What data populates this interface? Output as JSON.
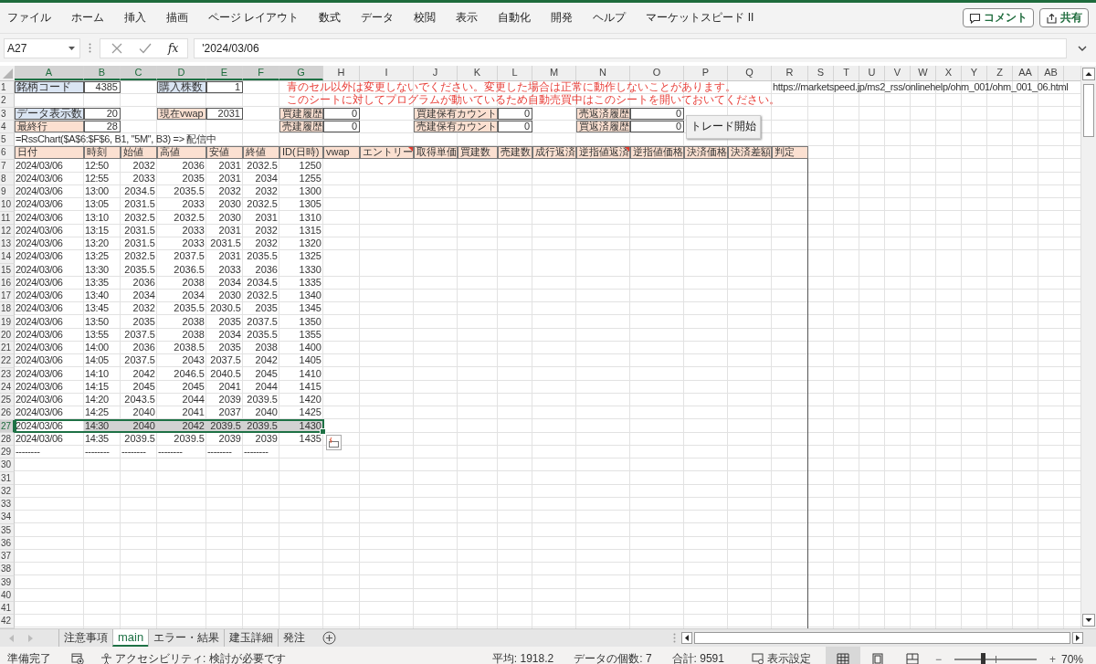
{
  "menu_tabs": [
    "ファイル",
    "ホーム",
    "挿入",
    "描画",
    "ページ レイアウト",
    "数式",
    "データ",
    "校閲",
    "表示",
    "自動化",
    "開発",
    "ヘルプ",
    "マーケットスピード II"
  ],
  "header_buttons": [
    {
      "kind": "comment",
      "label": "コメント"
    },
    {
      "kind": "share",
      "label": "共有"
    }
  ],
  "formula_bar": {
    "name_box": "A27",
    "function_label": "fx",
    "formula": "'2024/03/06"
  },
  "sheet": {
    "columns": [
      {
        "label": "A",
        "selected": true
      },
      {
        "label": "B",
        "selected": true
      },
      {
        "label": "C",
        "selected": true
      },
      {
        "label": "D",
        "selected": true
      },
      {
        "label": "E",
        "selected": true
      },
      {
        "label": "F",
        "selected": true
      },
      {
        "label": "G",
        "selected": true
      },
      {
        "label": "H",
        "selected": false
      },
      {
        "label": "I",
        "selected": false
      },
      {
        "label": "J",
        "selected": false
      },
      {
        "label": "K",
        "selected": false
      },
      {
        "label": "L",
        "selected": false
      },
      {
        "label": "M",
        "selected": false
      },
      {
        "label": "N",
        "selected": false
      },
      {
        "label": "O",
        "selected": false
      },
      {
        "label": "P",
        "selected": false
      },
      {
        "label": "Q",
        "selected": false
      },
      {
        "label": "R",
        "selected": false
      },
      {
        "label": "S",
        "selected": false
      },
      {
        "label": "T",
        "selected": false
      },
      {
        "label": "U",
        "selected": false
      },
      {
        "label": "V",
        "selected": false
      },
      {
        "label": "W",
        "selected": false
      },
      {
        "label": "X",
        "selected": false
      },
      {
        "label": "Y",
        "selected": false
      },
      {
        "label": "Z",
        "selected": false
      },
      {
        "label": "AA",
        "selected": false
      },
      {
        "label": "AB",
        "selected": false
      }
    ],
    "rows": [
      {
        "number": "1",
        "selected": false,
        "kind": "form",
        "cells": [
          {
            "kind": "label-blue",
            "text": "銘柄コード"
          },
          {
            "kind": "boxed",
            "text": "4385"
          },
          {
            "kind": "empty"
          },
          {
            "kind": "label-blue",
            "text": "購入株数"
          },
          {
            "kind": "boxed",
            "text": "1"
          },
          {
            "kind": "empty"
          },
          {
            "kind": "warning",
            "text": "青のセル以外は変更しないでください。変更した場合は正常に動作しないことがあります。"
          },
          {
            "kind": "empty"
          },
          {
            "kind": "empty"
          },
          {
            "kind": "empty"
          },
          {
            "kind": "empty"
          },
          {
            "kind": "empty"
          },
          {
            "kind": "empty"
          },
          {
            "kind": "empty"
          },
          {
            "kind": "empty"
          },
          {
            "kind": "empty"
          },
          {
            "kind": "empty"
          },
          {
            "kind": "text",
            "text": "https://marketspeed.jp/ms2_rss/onlinehelp/ohm_001/ohm_001_06.html"
          }
        ]
      },
      {
        "number": "2",
        "selected": false,
        "kind": "form",
        "cells": [
          {
            "kind": "empty"
          },
          {
            "kind": "empty"
          },
          {
            "kind": "empty"
          },
          {
            "kind": "empty"
          },
          {
            "kind": "empty"
          },
          {
            "kind": "empty"
          },
          {
            "kind": "warning",
            "text": "このシートに対してプログラムが動いているため自動売買中はこのシートを開いておいてください。"
          }
        ]
      },
      {
        "number": "3",
        "selected": false,
        "kind": "form",
        "cells": [
          {
            "kind": "label-blue",
            "text": "データ表示数"
          },
          {
            "kind": "boxed",
            "text": "20"
          },
          {
            "kind": "empty"
          },
          {
            "kind": "label",
            "text": "現在vwap"
          },
          {
            "kind": "boxed",
            "text": "2031"
          },
          {
            "kind": "empty"
          },
          {
            "kind": "label",
            "text": "買建履歴"
          },
          {
            "kind": "boxed",
            "text": "0"
          },
          {
            "kind": "empty"
          },
          {
            "kind": "label-wide",
            "text": "買建保有カウント"
          },
          {
            "kind": "boxed",
            "text": "0"
          },
          {
            "kind": "empty"
          },
          {
            "kind": "label",
            "text": "売返済履歴"
          },
          {
            "kind": "boxed",
            "text": "0"
          }
        ]
      },
      {
        "number": "4",
        "selected": false,
        "kind": "form",
        "cells": [
          {
            "kind": "label",
            "text": "最終行"
          },
          {
            "kind": "boxed",
            "text": "28"
          },
          {
            "kind": "empty"
          },
          {
            "kind": "empty"
          },
          {
            "kind": "empty"
          },
          {
            "kind": "empty"
          },
          {
            "kind": "label",
            "text": "売建履歴"
          },
          {
            "kind": "boxed",
            "text": "0"
          },
          {
            "kind": "empty"
          },
          {
            "kind": "label-wide",
            "text": "売建保有カウント"
          },
          {
            "kind": "boxed",
            "text": "0"
          },
          {
            "kind": "empty"
          },
          {
            "kind": "label",
            "text": "買返済履歴"
          },
          {
            "kind": "boxed",
            "text": "0"
          }
        ]
      },
      {
        "number": "5",
        "selected": false,
        "kind": "form",
        "cells": [
          {
            "kind": "text",
            "text": "=RssChart($A$6:$F$6, B1, \"5M\", B3) => 配信中"
          }
        ]
      },
      {
        "number": "6",
        "selected": false,
        "kind": "form",
        "cells": [
          {
            "kind": "label",
            "text": "日付"
          },
          {
            "kind": "label",
            "text": "時刻"
          },
          {
            "kind": "label",
            "text": "始値"
          },
          {
            "kind": "label",
            "text": "高値"
          },
          {
            "kind": "label",
            "text": "安値"
          },
          {
            "kind": "label",
            "text": "終値"
          },
          {
            "kind": "label",
            "text": "ID(日時)"
          },
          {
            "kind": "label",
            "text": "vwap"
          },
          {
            "kind": "label-note",
            "text": "エントリー"
          },
          {
            "kind": "label",
            "text": "取得単価"
          },
          {
            "kind": "label",
            "text": "買建数"
          },
          {
            "kind": "label",
            "text": "売建数"
          },
          {
            "kind": "label",
            "text": "成行返済"
          },
          {
            "kind": "label-note",
            "text": "逆指値返済"
          },
          {
            "kind": "label",
            "text": "逆指値価格"
          },
          {
            "kind": "label",
            "text": "決済価格"
          },
          {
            "kind": "label",
            "text": "決済差額"
          },
          {
            "kind": "label",
            "text": "判定"
          }
        ]
      },
      {
        "number": "7",
        "selected": false,
        "kind": "data",
        "values": [
          "2024/03/06",
          "12:50",
          "2032",
          "2036",
          "2031",
          "2032.5",
          "1250"
        ]
      },
      {
        "number": "8",
        "selected": false,
        "kind": "data",
        "values": [
          "2024/03/06",
          "12:55",
          "2033",
          "2035",
          "2031",
          "2034",
          "1255"
        ]
      },
      {
        "number": "9",
        "selected": false,
        "kind": "data",
        "values": [
          "2024/03/06",
          "13:00",
          "2034.5",
          "2035.5",
          "2032",
          "2032",
          "1300"
        ]
      },
      {
        "number": "10",
        "selected": false,
        "kind": "data",
        "values": [
          "2024/03/06",
          "13:05",
          "2031.5",
          "2033",
          "2030",
          "2032.5",
          "1305"
        ]
      },
      {
        "number": "11",
        "selected": false,
        "kind": "data",
        "values": [
          "2024/03/06",
          "13:10",
          "2032.5",
          "2032.5",
          "2030",
          "2031",
          "1310"
        ]
      },
      {
        "number": "12",
        "selected": false,
        "kind": "data",
        "values": [
          "2024/03/06",
          "13:15",
          "2031.5",
          "2033",
          "2031",
          "2032",
          "1315"
        ]
      },
      {
        "number": "13",
        "selected": false,
        "kind": "data",
        "values": [
          "2024/03/06",
          "13:20",
          "2031.5",
          "2033",
          "2031.5",
          "2032",
          "1320"
        ]
      },
      {
        "number": "14",
        "selected": false,
        "kind": "data",
        "values": [
          "2024/03/06",
          "13:25",
          "2032.5",
          "2037.5",
          "2031",
          "2035.5",
          "1325"
        ]
      },
      {
        "number": "15",
        "selected": false,
        "kind": "data",
        "values": [
          "2024/03/06",
          "13:30",
          "2035.5",
          "2036.5",
          "2033",
          "2036",
          "1330"
        ]
      },
      {
        "number": "16",
        "selected": false,
        "kind": "data",
        "values": [
          "2024/03/06",
          "13:35",
          "2036",
          "2038",
          "2034",
          "2034.5",
          "1335"
        ]
      },
      {
        "number": "17",
        "selected": false,
        "kind": "data",
        "values": [
          "2024/03/06",
          "13:40",
          "2034",
          "2034",
          "2030",
          "2032.5",
          "1340"
        ]
      },
      {
        "number": "18",
        "selected": false,
        "kind": "data",
        "values": [
          "2024/03/06",
          "13:45",
          "2032",
          "2035.5",
          "2030.5",
          "2035",
          "1345"
        ]
      },
      {
        "number": "19",
        "selected": false,
        "kind": "data",
        "values": [
          "2024/03/06",
          "13:50",
          "2035",
          "2038",
          "2035",
          "2037.5",
          "1350"
        ]
      },
      {
        "number": "20",
        "selected": false,
        "kind": "data",
        "values": [
          "2024/03/06",
          "13:55",
          "2037.5",
          "2038",
          "2034",
          "2035.5",
          "1355"
        ]
      },
      {
        "number": "21",
        "selected": false,
        "kind": "data",
        "values": [
          "2024/03/06",
          "14:00",
          "2036",
          "2038.5",
          "2035",
          "2038",
          "1400"
        ]
      },
      {
        "number": "22",
        "selected": false,
        "kind": "data",
        "values": [
          "2024/03/06",
          "14:05",
          "2037.5",
          "2043",
          "2037.5",
          "2042",
          "1405"
        ]
      },
      {
        "number": "23",
        "selected": false,
        "kind": "data",
        "values": [
          "2024/03/06",
          "14:10",
          "2042",
          "2046.5",
          "2040.5",
          "2045",
          "1410"
        ]
      },
      {
        "number": "24",
        "selected": false,
        "kind": "data",
        "values": [
          "2024/03/06",
          "14:15",
          "2045",
          "2045",
          "2041",
          "2044",
          "1415"
        ]
      },
      {
        "number": "25",
        "selected": false,
        "kind": "data",
        "values": [
          "2024/03/06",
          "14:20",
          "2043.5",
          "2044",
          "2039",
          "2039.5",
          "1420"
        ]
      },
      {
        "number": "26",
        "selected": false,
        "kind": "data",
        "values": [
          "2024/03/06",
          "14:25",
          "2040",
          "2041",
          "2037",
          "2040",
          "1425"
        ]
      },
      {
        "number": "27",
        "selected": true,
        "kind": "data",
        "values": [
          "2024/03/06",
          "14:30",
          "2040",
          "2042",
          "2039.5",
          "2039.5",
          "1430"
        ]
      },
      {
        "number": "28",
        "selected": false,
        "kind": "data",
        "values": [
          "2024/03/06",
          "14:35",
          "2039.5",
          "2039.5",
          "2039",
          "2039",
          "1435"
        ]
      },
      {
        "number": "29",
        "selected": false,
        "kind": "filler",
        "values": [
          "--------",
          "--------",
          "--------",
          "--------",
          "--------",
          "--------"
        ]
      },
      {
        "number": "30",
        "selected": false,
        "kind": "blank"
      },
      {
        "number": "31",
        "selected": false,
        "kind": "blank"
      },
      {
        "number": "32",
        "selected": false,
        "kind": "blank"
      },
      {
        "number": "33",
        "selected": false,
        "kind": "blank"
      },
      {
        "number": "34",
        "selected": false,
        "kind": "blank"
      },
      {
        "number": "35",
        "selected": false,
        "kind": "blank"
      },
      {
        "number": "36",
        "selected": false,
        "kind": "blank"
      },
      {
        "number": "37",
        "selected": false,
        "kind": "blank"
      },
      {
        "number": "38",
        "selected": false,
        "kind": "blank"
      },
      {
        "number": "39",
        "selected": false,
        "kind": "blank"
      },
      {
        "number": "40",
        "selected": false,
        "kind": "blank"
      },
      {
        "number": "41",
        "selected": false,
        "kind": "blank"
      },
      {
        "number": "42",
        "selected": false,
        "kind": "blank"
      }
    ],
    "floating_button": {
      "label": "トレード開始"
    }
  },
  "sheet_tabs": [
    {
      "label": "注意事項",
      "selected": false
    },
    {
      "label": "main",
      "selected": true
    },
    {
      "label": "エラー・結果",
      "selected": false
    },
    {
      "label": "建玉詳細",
      "selected": false
    },
    {
      "label": "発注",
      "selected": false
    }
  ],
  "status_bar": {
    "ready": "準備完了",
    "accessibility": "アクセシビリティ: 検討が必要です",
    "average": "平均: 1918.2",
    "count": "データの個数: 7",
    "sum": "合計: 9591",
    "display_settings": "表示設定",
    "views": [
      {
        "kind": "normal",
        "selected": true
      },
      {
        "kind": "page-layout",
        "selected": false
      },
      {
        "kind": "page-break",
        "selected": false
      }
    ],
    "zoom_minus": "−",
    "zoom_plus": "+",
    "zoom": {
      "level": 0.34
    },
    "zoom_percent": "70%"
  }
}
